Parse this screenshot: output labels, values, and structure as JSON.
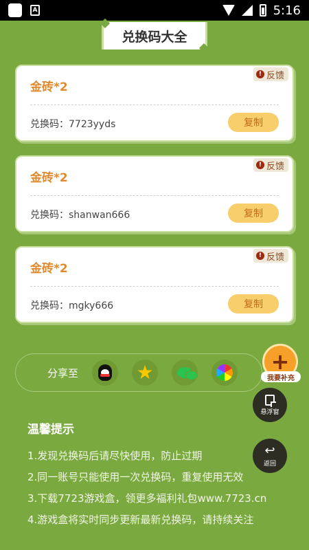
{
  "status_bar": {
    "time": "5:16"
  },
  "header": {
    "title": "兑换码大全"
  },
  "cards": [
    {
      "title": "金砖*2",
      "feedback": "反馈",
      "code_label": "兑换码：7723yyds",
      "copy_label": "复制"
    },
    {
      "title": "金砖*2",
      "feedback": "反馈",
      "code_label": "兑换码：shanwan666",
      "copy_label": "复制"
    },
    {
      "title": "金砖*2",
      "feedback": "反馈",
      "code_label": "兑换码：mgky666",
      "copy_label": "复制"
    }
  ],
  "share": {
    "label": "分享至",
    "icons": [
      "qq-icon",
      "qzone-star-icon",
      "wechat-icon",
      "moments-icon"
    ]
  },
  "tips": {
    "title": "温馨提示",
    "items": [
      "1.发现兑换码后请尽快使用，防止过期",
      "2.同一账号只能使用一次兑换码，重复使用无效",
      "3.下载7723游戏盒，领更多福利礼包www.7723.cn",
      "4.游戏盒将实时同步更新最新兑换码，请持续关注"
    ]
  },
  "floating": {
    "supplement_label": "我要补充",
    "float_window_label": "悬浮窗",
    "back_label": "返回"
  },
  "colors": {
    "background": "#7aa93f",
    "title_orange": "#e08a2e",
    "copy_button": "#f7ce6a"
  }
}
